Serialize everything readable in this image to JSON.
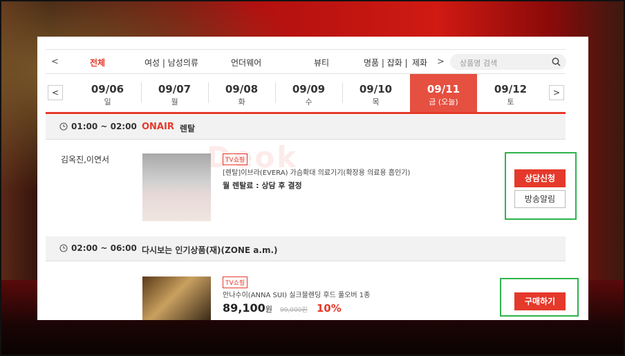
{
  "nav": {
    "prev": "<",
    "next": ">",
    "categories": [
      "전체",
      "여성 | 남성의류",
      "언더웨어",
      "뷰티",
      "명품 | 잡화 |",
      "제화"
    ],
    "active_category": "전체",
    "search_placeholder": "상품명 검색"
  },
  "dates": {
    "prev": "<",
    "next": ">",
    "days": [
      {
        "date": "09/06",
        "weekday": "일"
      },
      {
        "date": "09/07",
        "weekday": "월"
      },
      {
        "date": "09/08",
        "weekday": "화"
      },
      {
        "date": "09/09",
        "weekday": "수"
      },
      {
        "date": "09/10",
        "weekday": "목"
      },
      {
        "date": "09/11",
        "weekday": "금 (오늘)"
      },
      {
        "date": "09/12",
        "weekday": "토"
      }
    ]
  },
  "slots": [
    {
      "time": "01:00 ~ 02:00",
      "onair": "ONAIR",
      "tag": "렌탈",
      "host": "김옥진,이연서",
      "badge": "TV쇼핑",
      "product_name": "[렌탈]이브라(EVERA) 가슴확대 의료기기(확장용 의료용 흡인기)",
      "rental_text": "월 렌탈료 : 상담 후 결정",
      "primary_button": "상담신청",
      "secondary_button": "방송알림"
    },
    {
      "time": "02:00 ~ 06:00",
      "tag": "다시보는 인기상품(재)(ZONE a.m.)",
      "badge": "TV쇼핑",
      "product_name": "안나수이(ANNA SUI) 실크블렌딩 후드 풀오버 1종",
      "price": "89,100",
      "price_unit": "원",
      "original_price": "99,000원",
      "discount": "10%",
      "primary_button": "구매하기"
    }
  ],
  "watermark": "Deok",
  "colors": {
    "accent": "#e5392b",
    "highlight": "#2db34a"
  }
}
